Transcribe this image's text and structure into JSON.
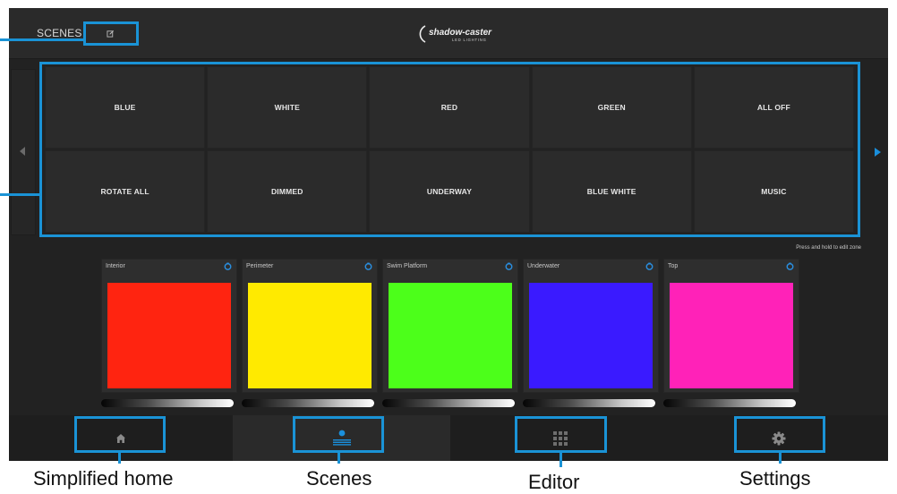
{
  "header": {
    "title": "SCENES",
    "edit_icon": "edit-icon",
    "logo_text": "shadow-caster",
    "logo_subtext": "LED LIGHTING"
  },
  "scenes": [
    {
      "label": "BLUE"
    },
    {
      "label": "WHITE"
    },
    {
      "label": "RED"
    },
    {
      "label": "GREEN"
    },
    {
      "label": "ALL OFF"
    },
    {
      "label": "ROTATE ALL"
    },
    {
      "label": "DIMMED"
    },
    {
      "label": "UNDERWAY"
    },
    {
      "label": "BLUE WHITE"
    },
    {
      "label": "MUSIC"
    }
  ],
  "hint": "Press and hold to edit zone",
  "zones": [
    {
      "name": "Interior",
      "color": "#ff2410"
    },
    {
      "name": "Perimeter",
      "color": "#ffea00"
    },
    {
      "name": "Swim Platform",
      "color": "#4cff1a"
    },
    {
      "name": "Underwater",
      "color": "#3a1aff"
    },
    {
      "name": "Top",
      "color": "#ff22b8"
    }
  ],
  "nav": [
    {
      "icon": "home-icon",
      "caption": "Simplified home"
    },
    {
      "icon": "scenes-icon",
      "caption": "Scenes"
    },
    {
      "icon": "grid-icon",
      "caption": "Editor"
    },
    {
      "icon": "gear-icon",
      "caption": "Settings"
    }
  ],
  "colors": {
    "accent": "#1a93d6",
    "background": "#222222"
  }
}
